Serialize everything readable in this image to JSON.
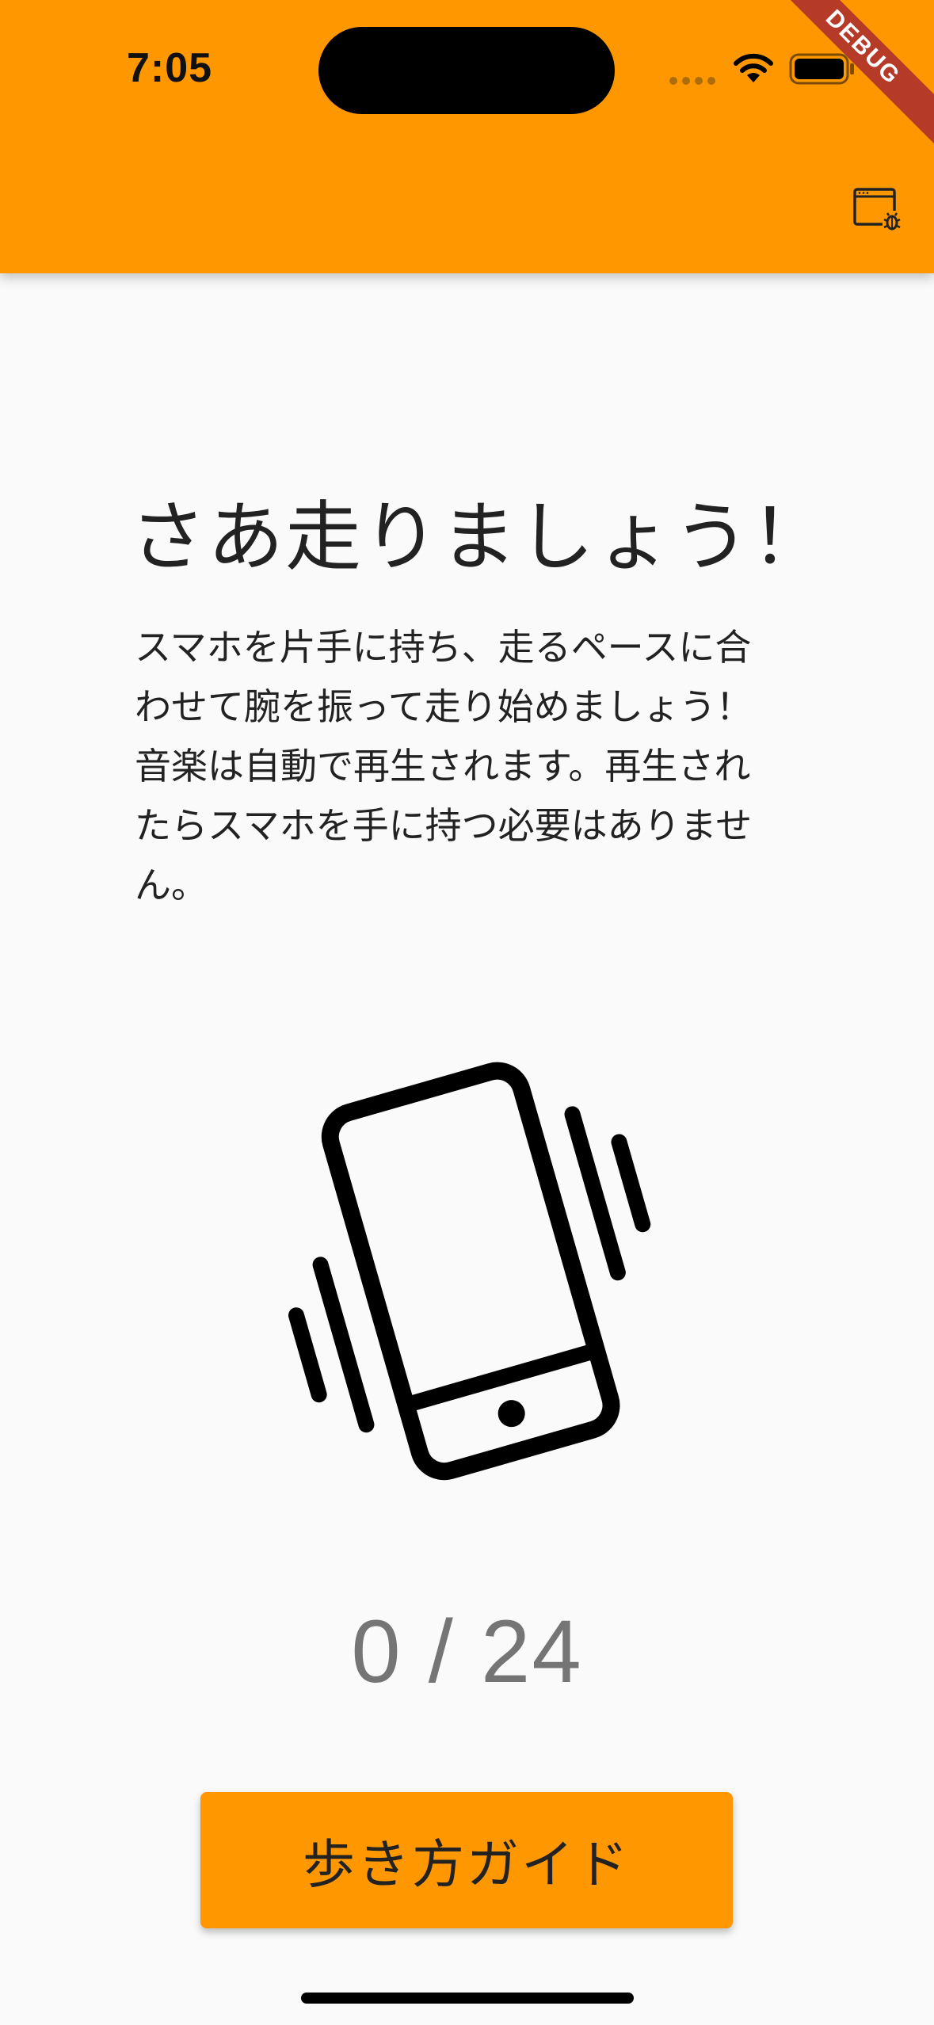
{
  "status_bar": {
    "time": "7:05"
  },
  "app_bar": {
    "color": "#ff9800",
    "debug_banner": "DEBUG",
    "action_icon": "browser-bug-icon"
  },
  "main": {
    "title": "さあ走りましょう！",
    "description": "スマホを片手に持ち、走るペースに合わせて腕を振って走り始めましょう！音楽は自動で再生されます。再生されたらスマホを手に持つ必要はありません。",
    "illustration_icon": "phone-shake-icon",
    "counter": "0 / 24",
    "guide_button_label": "歩き方ガイド"
  }
}
